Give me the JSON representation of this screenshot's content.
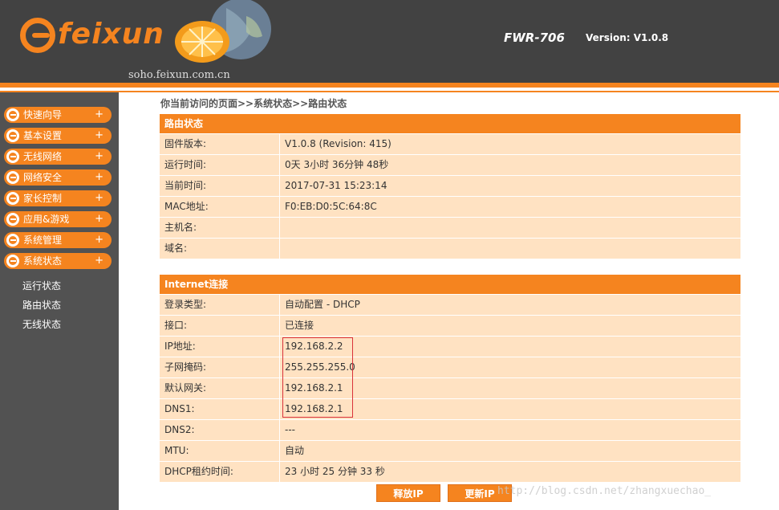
{
  "header": {
    "logo_text": "feixun",
    "domain": "soho.feixun.com.cn",
    "model": "FWR-706",
    "version": "Version: V1.0.8"
  },
  "sidebar": {
    "menu": [
      {
        "label": "快速向导",
        "expand": "+"
      },
      {
        "label": "基本设置",
        "expand": "+"
      },
      {
        "label": "无线网络",
        "expand": "+"
      },
      {
        "label": "网络安全",
        "expand": "+"
      },
      {
        "label": "家长控制",
        "expand": "+"
      },
      {
        "label": "应用&游戏",
        "expand": "+"
      },
      {
        "label": "系统管理",
        "expand": "+"
      },
      {
        "label": "系统状态",
        "expand": "+"
      }
    ],
    "submenu": [
      "运行状态",
      "路由状态",
      "无线状态"
    ]
  },
  "breadcrumb": "你当前访问的页面>>系统状态>>路由状态",
  "router_status": {
    "title": "路由状态",
    "rows": [
      {
        "k": "固件版本:",
        "v": "V1.0.8 (Revision: 415)"
      },
      {
        "k": "运行时间:",
        "v": "0天 3小时 36分钟 48秒"
      },
      {
        "k": "当前时间:",
        "v": "2017-07-31 15:23:14"
      },
      {
        "k": "MAC地址:",
        "v": "F0:EB:D0:5C:64:8C"
      },
      {
        "k": "主机名:",
        "v": ""
      },
      {
        "k": "域名:",
        "v": ""
      }
    ]
  },
  "internet": {
    "title": "Internet连接",
    "rows": [
      {
        "k": "登录类型:",
        "v": "自动配置 - DHCP"
      },
      {
        "k": "接口:",
        "v": "已连接"
      },
      {
        "k": "IP地址:",
        "v": "192.168.2.2"
      },
      {
        "k": "子网掩码:",
        "v": "255.255.255.0"
      },
      {
        "k": "默认网关:",
        "v": "192.168.2.1"
      },
      {
        "k": "DNS1:",
        "v": "192.168.2.1"
      },
      {
        "k": "DNS2:",
        "v": "---"
      },
      {
        "k": "MTU:",
        "v": "自动"
      },
      {
        "k": "DHCP租约时间:",
        "v": "23 小时 25 分钟 33 秒"
      }
    ]
  },
  "buttons": {
    "release": "释放IP",
    "renew": "更新IP"
  },
  "watermark": "http://blog.csdn.net/zhangxuechao_",
  "colors": {
    "accent": "#f5841f",
    "header_bg": "#424242",
    "sidebar_bg": "#525252",
    "row_bg": "#ffe2c2",
    "highlight_border": "#d9323a"
  }
}
